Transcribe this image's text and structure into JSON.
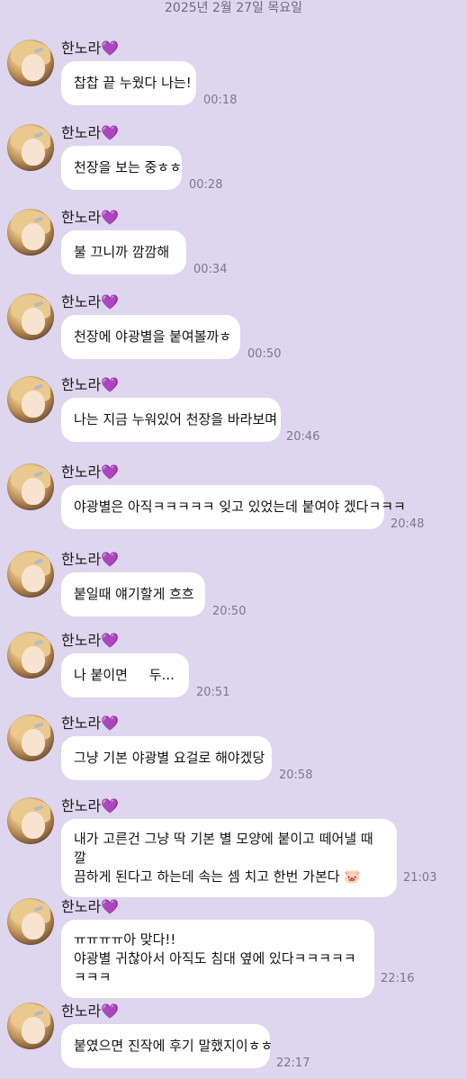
{
  "date_header": "2025년 2월 27일 목요일",
  "sender_name": "한노라💜",
  "messages": [
    {
      "text": "찹찹 끝 누웠다 나는!",
      "time": "00:18"
    },
    {
      "text": "천장을 보는 중ㅎㅎ",
      "time": "00:28"
    },
    {
      "text": "불 끄니까 깜깜해",
      "time": "00:34"
    },
    {
      "text": "천장에 야광별을 붙여볼까ㅎ",
      "time": "00:50"
    },
    {
      "text": "나는 지금 누워있어 천장을 바라보며",
      "time": "20:46"
    },
    {
      "text": "야광별은 아직ㅋㅋㅋㅋㅋ 잊고 있었는데 붙여야 겠다ㅋㅋㅋ",
      "time": "20:48"
    },
    {
      "text": "붙일때 얘기할게 흐흐",
      "time": "20:50"
    },
    {
      "text": "나 붙이면     두...",
      "time": "20:51"
    },
    {
      "text": "그냥 기본 야광별 요걸로 해야겠당",
      "time": "20:58"
    },
    {
      "lines": [
        "내가 고른건 그냥 딱 기본 별 모양에 붙이고 떼어낼 때 깔",
        "끔하게 된다고 하는데 속는 셈 치고 한번 가본다 🐷"
      ],
      "time": "21:03"
    },
    {
      "lines": [
        "ㅠㅠㅠㅠ아 맞다!!",
        "야광별 귀찮아서 아직도 침대 옆에 있다ㅋㅋㅋㅋㅋㅋㅋㅋ"
      ],
      "time": "22:16"
    },
    {
      "text": "붙였으면 진작에 후기 말했지이ㅎㅎ",
      "time": "22:17"
    }
  ]
}
